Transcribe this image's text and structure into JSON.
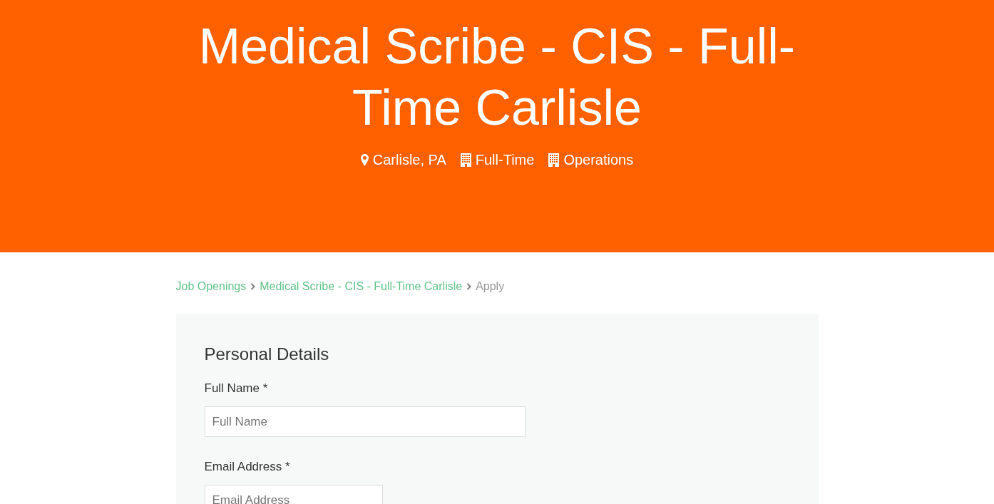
{
  "header": {
    "title": "Medical Scribe - CIS - Full-Time Carlisle",
    "meta": [
      {
        "kind": "location",
        "text": "Carlisle, PA"
      },
      {
        "kind": "building",
        "text": "Full-Time"
      },
      {
        "kind": "building",
        "text": "Operations"
      }
    ]
  },
  "breadcrumb": [
    {
      "kind": "link",
      "label": "Job Openings"
    },
    {
      "kind": "link",
      "label": "Medical Scribe - CIS - Full-Time Carlisle"
    },
    {
      "kind": "current",
      "label": "Apply"
    }
  ],
  "form": {
    "section_title": "Personal Details",
    "fields": [
      {
        "kind": "wide",
        "label": "Full Name *",
        "placeholder": "Full Name"
      },
      {
        "kind": "narrow",
        "label": "Email Address *",
        "placeholder": "Email Address"
      }
    ]
  }
}
